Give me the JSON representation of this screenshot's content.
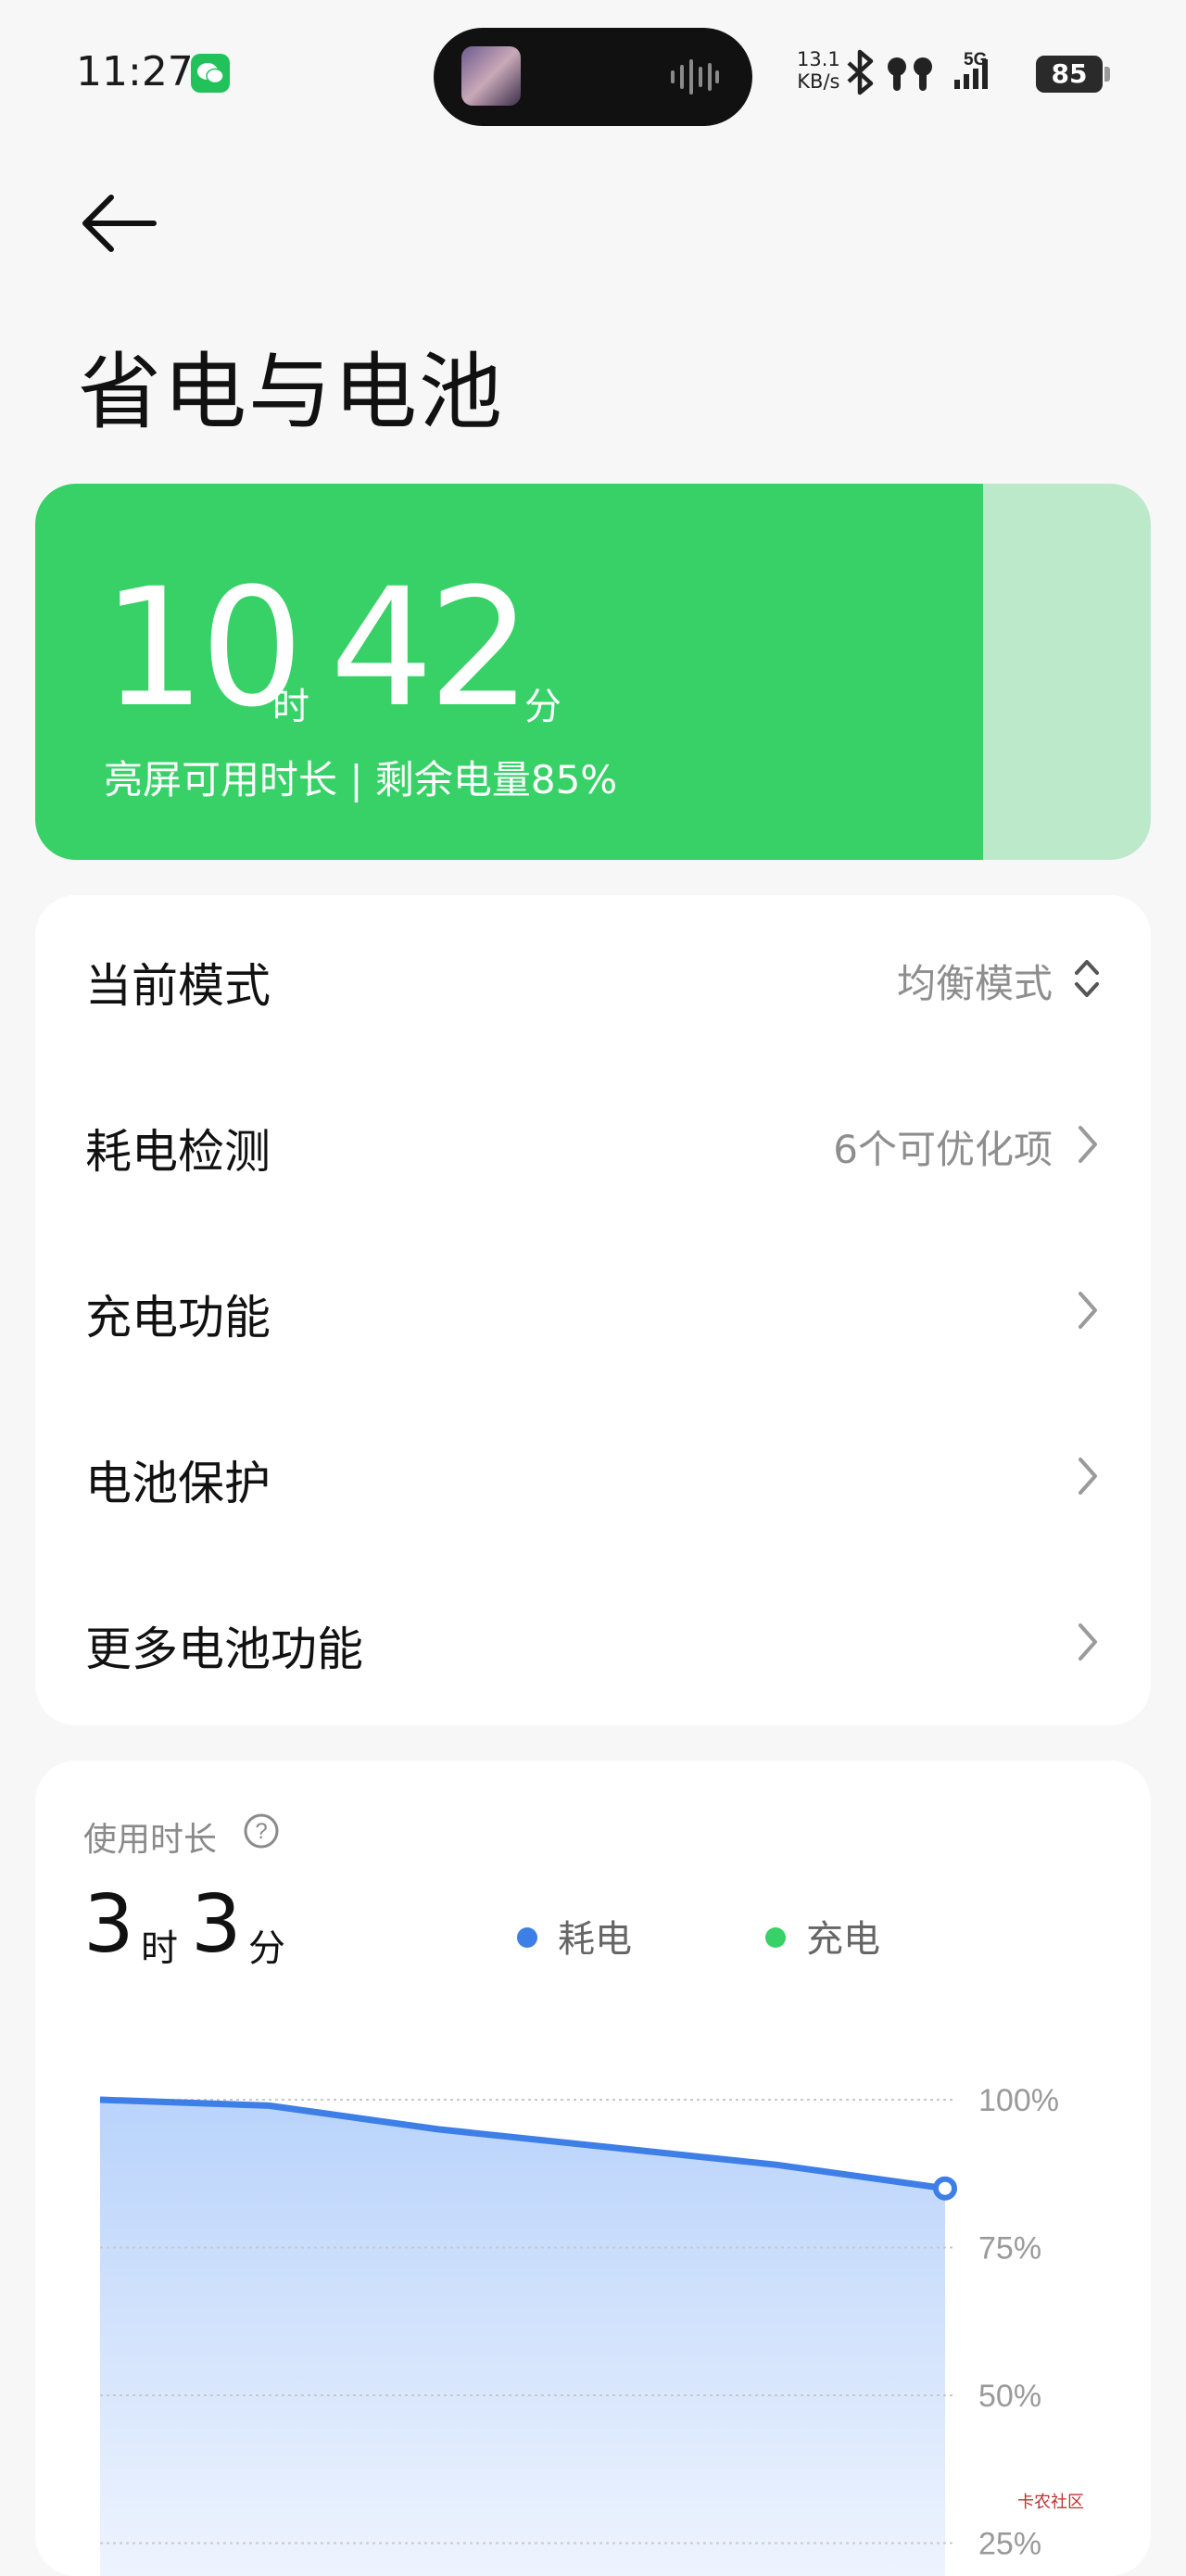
{
  "status_bar": {
    "time": "11:27",
    "net_speed_value": "13.1",
    "net_speed_unit": "KB/s",
    "signal_label": "5G",
    "battery_level": "85"
  },
  "header": {
    "back_icon": "arrow-left-icon",
    "title": "省电与电池"
  },
  "battery_card": {
    "hours": "10",
    "hours_unit": "时",
    "minutes": "42",
    "minutes_unit": "分",
    "subtitle": "亮屏可用时长 | 剩余电量85%",
    "level_fraction": 0.85,
    "fill_color": "#37d167",
    "track_color": "#bde9cb"
  },
  "settings": {
    "rows": [
      {
        "label": "当前模式",
        "value": "均衡模式",
        "icon": "chevron-up-down-icon"
      },
      {
        "label": "耗电检测",
        "value": "6个可优化项",
        "icon": "chevron-right-icon"
      },
      {
        "label": "充电功能",
        "value": "",
        "icon": "chevron-right-icon"
      },
      {
        "label": "电池保护",
        "value": "",
        "icon": "chevron-right-icon"
      },
      {
        "label": "更多电池功能",
        "value": "",
        "icon": "chevron-right-icon"
      }
    ]
  },
  "usage": {
    "label": "使用时长",
    "hours": "3",
    "hours_unit": "时",
    "minutes": "3",
    "minutes_unit": "分",
    "legend": [
      {
        "name": "耗电",
        "color": "#3d7fe6"
      },
      {
        "name": "充电",
        "color": "#37d167"
      }
    ]
  },
  "chart_data": {
    "type": "area",
    "y_ticks": [
      "100%",
      "75%",
      "50%",
      "25%"
    ],
    "ylim": [
      0,
      100
    ],
    "series": [
      {
        "name": "耗电",
        "color": "#3d7fe6",
        "values": [
          100,
          99,
          95,
          92,
          89,
          85
        ]
      }
    ],
    "grid": true
  },
  "watermark": "卡农社区"
}
